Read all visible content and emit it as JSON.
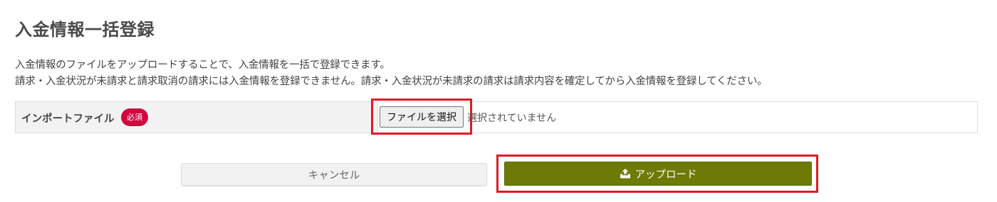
{
  "page": {
    "title": "入金情報一括登録",
    "description": [
      "入金情報のファイルをアップロードすることで、入金情報を一括で登録できます。",
      "請求・入金状況が未請求と請求取消の請求には入金情報を登録できません。請求・入金状況が未請求の請求は請求内容を確定してから入金情報を登録してください。"
    ]
  },
  "form": {
    "import_file": {
      "label": "インポートファイル",
      "required_badge": "必須",
      "choose_button": "ファイルを選択",
      "status": "選択されていません"
    }
  },
  "actions": {
    "cancel_label": "キャンセル",
    "upload_label": "アップロード",
    "upload_icon": "upload-tray-icon"
  },
  "colors": {
    "upload_button_bg": "#6e7a06",
    "required_badge_bg": "#d0083e",
    "highlight_border": "#e01b24"
  }
}
